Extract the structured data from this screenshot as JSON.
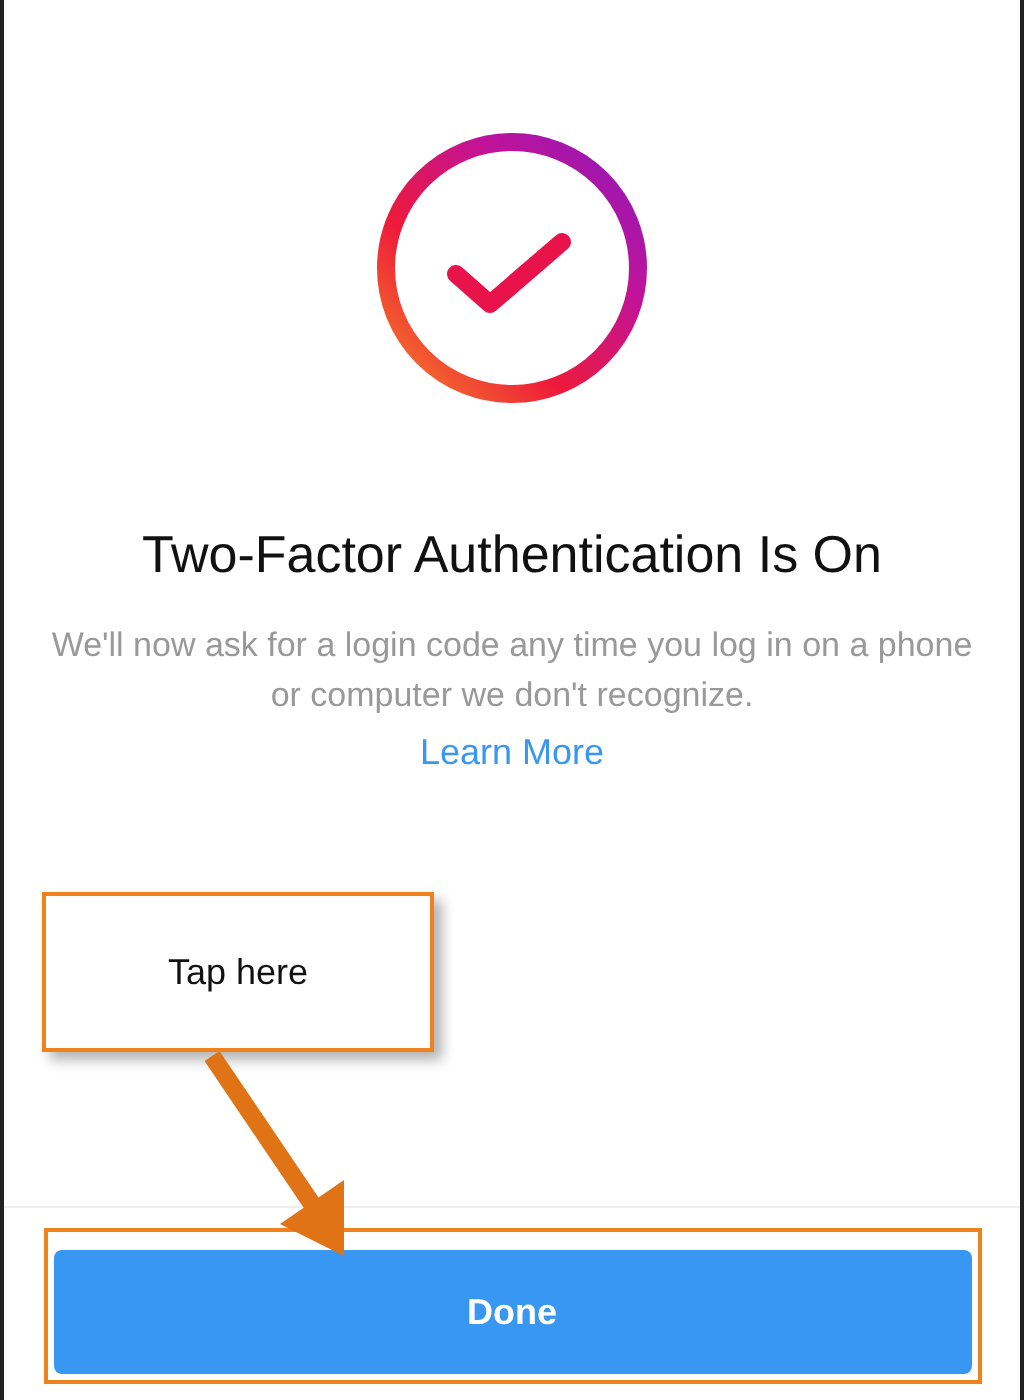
{
  "title": "Two-Factor Authentication Is On",
  "description": "We'll now ask for a login code any time you log in on a phone or computer we don't recognize.",
  "link": "Learn More",
  "button": "Done",
  "annotation": {
    "callout": "Tap here"
  }
}
